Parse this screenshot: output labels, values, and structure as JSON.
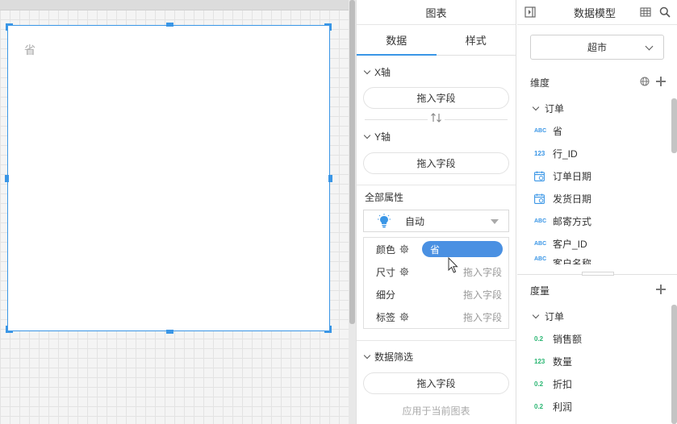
{
  "canvas": {
    "widget_title": "省"
  },
  "chart_panel": {
    "title": "图表",
    "tabs": [
      {
        "label": "数据",
        "active": true
      },
      {
        "label": "样式",
        "active": false
      }
    ],
    "x_axis": {
      "label": "X轴",
      "placeholder": "拖入字段"
    },
    "swap_icon": "swap-vertical-icon",
    "y_axis": {
      "label": "Y轴",
      "placeholder": "拖入字段"
    },
    "all_attributes": {
      "label": "全部属性",
      "mode": "自动",
      "rows": [
        {
          "label": "颜色",
          "has_gear": true,
          "field": "省"
        },
        {
          "label": "尺寸",
          "has_gear": true,
          "placeholder": "拖入字段"
        },
        {
          "label": "细分",
          "has_gear": false,
          "placeholder": "拖入字段"
        },
        {
          "label": "标签",
          "has_gear": true,
          "placeholder": "拖入字段"
        }
      ]
    },
    "data_filter": {
      "label": "数据筛选",
      "placeholder": "拖入字段"
    },
    "apply_text": "应用于当前图表"
  },
  "model_panel": {
    "title": "数据模型",
    "dataset": "超市",
    "dimensions": {
      "label": "维度",
      "group": "订单",
      "items": [
        {
          "type": "ABC",
          "name": "省"
        },
        {
          "type": "123",
          "name": "行_ID"
        },
        {
          "type": "date",
          "name": "订单日期"
        },
        {
          "type": "date",
          "name": "发货日期"
        },
        {
          "type": "ABC",
          "name": "邮寄方式"
        },
        {
          "type": "ABC",
          "name": "客户_ID"
        },
        {
          "type": "ABC",
          "name": "客户名称"
        }
      ]
    },
    "measures": {
      "label": "度量",
      "group": "订单",
      "items": [
        {
          "type": "0.2",
          "name": "销售额"
        },
        {
          "type": "123",
          "name": "数量"
        },
        {
          "type": "0.2",
          "name": "折扣"
        },
        {
          "type": "0.2",
          "name": "利润"
        }
      ]
    }
  },
  "colors": {
    "accent": "#3a96e6",
    "pill": "#4a90e2",
    "measure_badge": "#2bb673"
  }
}
